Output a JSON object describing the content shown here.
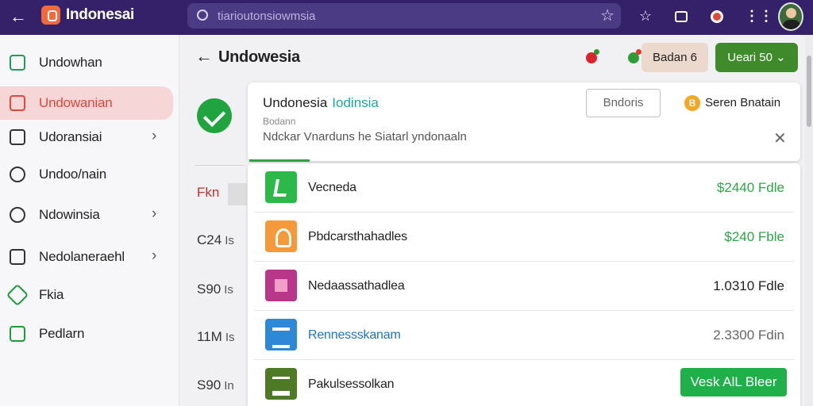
{
  "browser": {
    "app_title": "Indonesai",
    "url": "tiarioutonsiowmsia"
  },
  "sidebar": {
    "items": [
      {
        "label": "Undowhan",
        "active": false,
        "chevron": false
      },
      {
        "label": "Undowanian",
        "active": true,
        "chevron": false
      },
      {
        "label": "Udoransiai",
        "active": false,
        "chevron": true
      },
      {
        "label": "Undoo/nain",
        "active": false,
        "chevron": false
      },
      {
        "label": "Ndowinsia",
        "active": false,
        "chevron": true
      },
      {
        "label": "Nedolaneraehl",
        "active": false,
        "chevron": true
      },
      {
        "label": "Fkia",
        "active": false,
        "chevron": false
      },
      {
        "label": "Pedlarn",
        "active": false,
        "chevron": false
      }
    ]
  },
  "header": {
    "title": "Undowesia",
    "secondary_button": "Badan 6",
    "primary_button": "Ueari 50"
  },
  "left_column": {
    "values": [
      {
        "value": "Fkn",
        "tag": ""
      },
      {
        "value": "C24",
        "tag": "Is"
      },
      {
        "value": "S90",
        "tag": "Is"
      },
      {
        "value": "11M",
        "tag": "Is"
      },
      {
        "value": "S90",
        "tag": "In"
      }
    ]
  },
  "info_card": {
    "title": "Undonesia",
    "title_accent": "Iodinsia",
    "subtitle": "Bodann",
    "description": "Ndckar Vnarduns he Siatarl yndonaaln",
    "action_button": "Bndoris",
    "coin_symbol": "B",
    "coin_label": "Seren Bnatain"
  },
  "list": {
    "rows": [
      {
        "name": "Vecneda",
        "amount": "$2440 Fdle",
        "amount_style": "green",
        "icon": "green-document-icon",
        "name_style": ""
      },
      {
        "name": "Pbdcarsthahadles",
        "amount": "$240 Fble",
        "amount_style": "green",
        "icon": "orange-user-icon",
        "name_style": ""
      },
      {
        "name": "Nedaassathadlea",
        "amount": "1.0310 Fdle",
        "amount_style": "",
        "icon": "pink-file-icon",
        "name_style": ""
      },
      {
        "name": "Rennessskanam",
        "amount": "2.3300 Fdin",
        "amount_style": "grey",
        "icon": "blue-drive-icon",
        "name_style": "blue"
      },
      {
        "name": "Pakulsessolkan",
        "button": "Vesk AlL Bleer",
        "icon": "olive-list-icon",
        "name_style": ""
      }
    ]
  }
}
